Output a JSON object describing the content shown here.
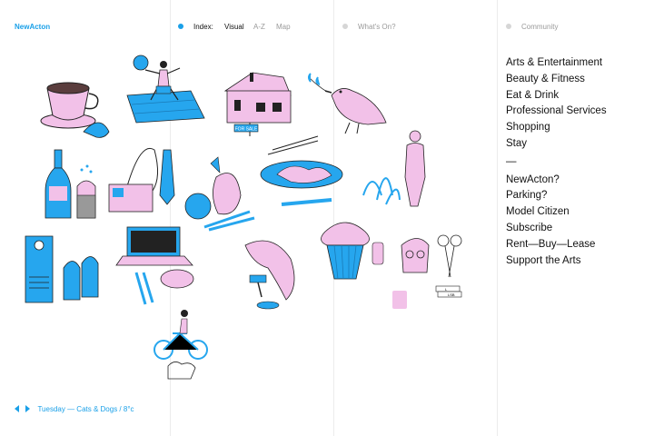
{
  "brand": "NewActon",
  "nav": {
    "index_label": "Index:",
    "visual_label": "Visual",
    "az_label": "A-Z",
    "map_label": "Map",
    "whats_on_label": "What's On?",
    "community_label": "Community"
  },
  "categories": [
    "Arts & Entertainment",
    "Beauty & Fitness",
    "Eat & Drink",
    "Professional Services",
    "Shopping",
    "Stay"
  ],
  "separator": "—",
  "links": [
    "NewActon?",
    "Parking?",
    "Model Citizen",
    "Subscribe",
    "Rent—Buy—Lease",
    "Support the Arts"
  ],
  "footer": {
    "text": "Tuesday — Cats & Dogs / 8°c"
  },
  "illustrations": {
    "for_sale_sign": "FOR SALE",
    "books_labels": [
      "L",
      "LSB"
    ]
  },
  "colors": {
    "accent": "#1aa0e8",
    "pink": "#f2c1e8",
    "blue": "#26a6ee",
    "ink": "#111111"
  },
  "icons": {
    "prev": "chevron-left-icon",
    "next": "chevron-right-icon"
  }
}
